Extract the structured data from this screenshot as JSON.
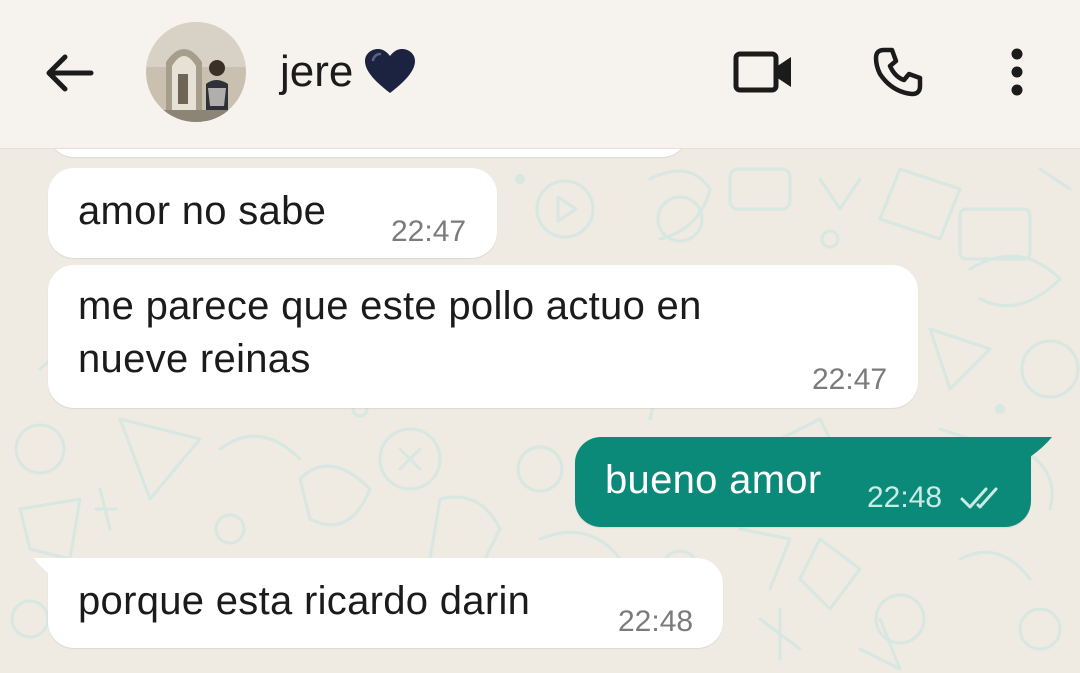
{
  "header": {
    "contact_name": "jere",
    "name_emoji": "💙",
    "back_icon": "arrow-left-icon",
    "video_icon": "video-camera-icon",
    "call_icon": "phone-icon",
    "menu_icon": "more-vertical-icon"
  },
  "messages": [
    {
      "direction": "incoming",
      "text": "amor no sabe",
      "time": "22:47"
    },
    {
      "direction": "incoming",
      "text_lines": [
        "me parece que este pollo actuo en",
        "nueve reinas"
      ],
      "time": "22:47"
    },
    {
      "direction": "outgoing",
      "text": "bueno amor",
      "time": "22:48",
      "status": "read-ticks"
    },
    {
      "direction": "incoming",
      "text": "porque esta ricardo darin",
      "time": "22:48"
    }
  ],
  "colors": {
    "header_bg": "#f6f3ee",
    "chat_bg": "#efeae2",
    "incoming_bubble": "#ffffff",
    "outgoing_bubble": "#0b8a79",
    "heart": "#1c2340"
  }
}
